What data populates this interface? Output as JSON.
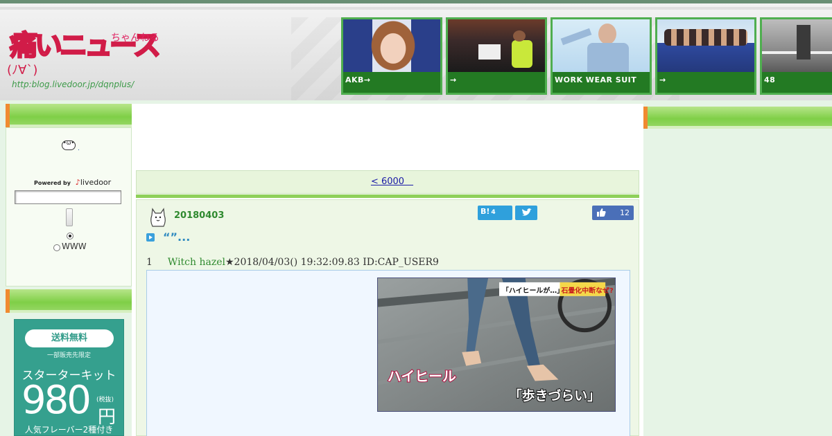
{
  "header": {
    "logo_url_text": "http:blog.livedoor.jp/dqnplus/",
    "logo_main": "痛いニュース",
    "logo_sub": "ちゃんねる",
    "logo_face": "(ﾉ∀`)",
    "thumbs": [
      {
        "label": "AKB→"
      },
      {
        "label": "→"
      },
      {
        "label": "WORK WEAR SUIT"
      },
      {
        "label": "→"
      },
      {
        "label": "48"
      }
    ]
  },
  "sidebar": {
    "powered_by": "Powered by",
    "livedoor": "livedoor",
    "search_value": "",
    "radio_www": "WWW",
    "ad": {
      "pill": "送料無料",
      "sub": "一部販売先限定",
      "title": "スターターキット",
      "price": "980",
      "tax": "(税抜)",
      "yen": "円",
      "bottom": "人気フレーバー2種付き"
    }
  },
  "main": {
    "page_nav": "< 6000　",
    "article": {
      "date": "20180403",
      "hatena_count": "4",
      "hatena_label": "B!",
      "like_count": "12",
      "title": "“”...",
      "post_number": "1",
      "post_name": "Witch hazel",
      "post_meta": "★2018/04/03() 19:32:09.83 ID:CAP_USER9",
      "image_caption_top_a": "「ハイヒールが…」",
      "image_caption_top_b": "石畳化中断なぜ?",
      "image_caption_left": "ハイヒール",
      "image_caption_right": "「歩きづらい」"
    }
  },
  "colors": {
    "accent_green": "#7fcf47",
    "accent_orange": "#f08a30",
    "link_blue": "#1a1aa6",
    "date_green": "#2f8a2f"
  }
}
